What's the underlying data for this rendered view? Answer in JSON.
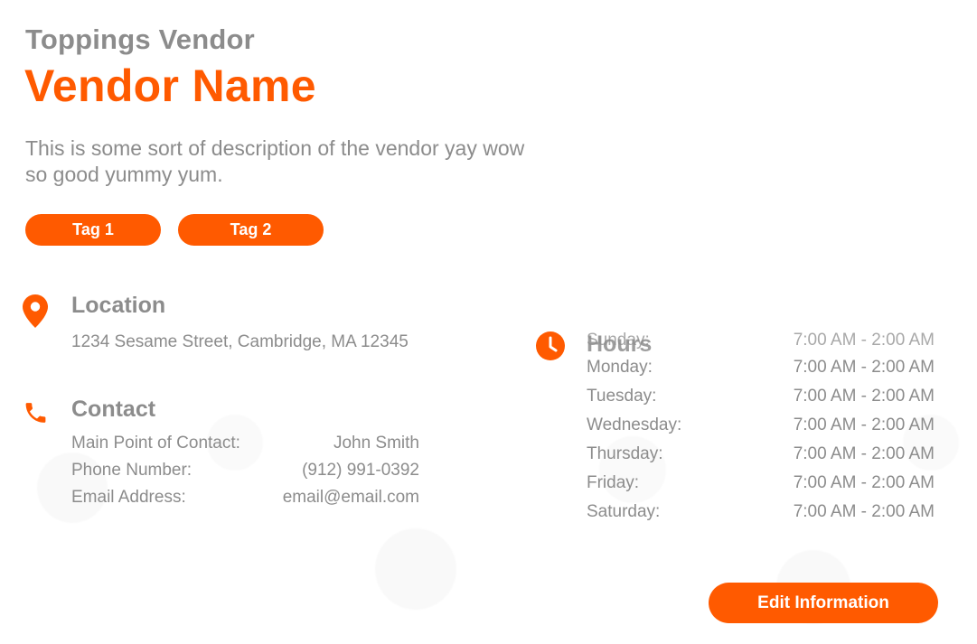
{
  "header": {
    "subtitle": "Toppings Vendor",
    "title": "Vendor Name",
    "description": "This is some sort of description of the vendor yay wow so good yummy yum."
  },
  "tags": [
    "Tag 1",
    "Tag 2"
  ],
  "location": {
    "heading": "Location",
    "address": "1234 Sesame Street, Cambridge, MA 12345",
    "icon": "map-pin-icon"
  },
  "contact": {
    "heading": "Contact",
    "icon": "phone-icon",
    "rows": [
      {
        "label": "Main Point of Contact:",
        "value": "John Smith"
      },
      {
        "label": "Phone Number:",
        "value": "(912) 991-0392"
      },
      {
        "label": "Email Address:",
        "value": "email@email.com"
      }
    ]
  },
  "hours": {
    "heading": "Hours",
    "icon": "clock-icon",
    "rows": [
      {
        "day": "Sunday:",
        "time": "7:00 AM - 2:00 AM"
      },
      {
        "day": "Monday:",
        "time": "7:00 AM - 2:00 AM"
      },
      {
        "day": "Tuesday:",
        "time": "7:00 AM - 2:00 AM"
      },
      {
        "day": "Wednesday:",
        "time": "7:00 AM - 2:00 AM"
      },
      {
        "day": "Thursday:",
        "time": "7:00 AM - 2:00 AM"
      },
      {
        "day": "Friday:",
        "time": "7:00 AM - 2:00 AM"
      },
      {
        "day": "Saturday:",
        "time": "7:00 AM - 2:00 AM"
      }
    ]
  },
  "actions": {
    "edit_label": "Edit Information"
  },
  "colors": {
    "accent": "#ff5a00",
    "text_muted": "#8c8c8c",
    "background": "#ffffff"
  }
}
